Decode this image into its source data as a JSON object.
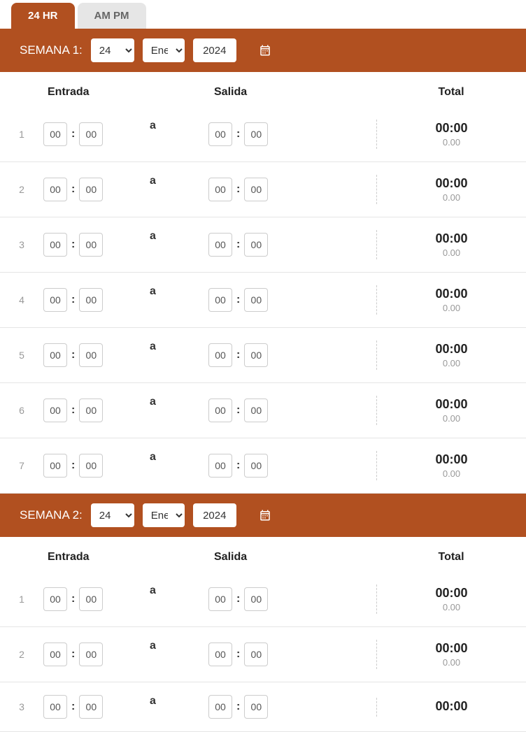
{
  "tabs": {
    "t24": "24 HR",
    "ampm": "AM PM"
  },
  "headers": {
    "entrada": "Entrada",
    "salida": "Salida",
    "total": "Total"
  },
  "a_label": "a",
  "weeks": [
    {
      "label": "SEMANA 1:",
      "day": "24",
      "month": "Enero",
      "year": "2024",
      "rows": [
        {
          "n": "1",
          "eh": "00",
          "em": "00",
          "sh": "00",
          "sm": "00",
          "tt": "00:00",
          "td": "0.00"
        },
        {
          "n": "2",
          "eh": "00",
          "em": "00",
          "sh": "00",
          "sm": "00",
          "tt": "00:00",
          "td": "0.00"
        },
        {
          "n": "3",
          "eh": "00",
          "em": "00",
          "sh": "00",
          "sm": "00",
          "tt": "00:00",
          "td": "0.00"
        },
        {
          "n": "4",
          "eh": "00",
          "em": "00",
          "sh": "00",
          "sm": "00",
          "tt": "00:00",
          "td": "0.00"
        },
        {
          "n": "5",
          "eh": "00",
          "em": "00",
          "sh": "00",
          "sm": "00",
          "tt": "00:00",
          "td": "0.00"
        },
        {
          "n": "6",
          "eh": "00",
          "em": "00",
          "sh": "00",
          "sm": "00",
          "tt": "00:00",
          "td": "0.00"
        },
        {
          "n": "7",
          "eh": "00",
          "em": "00",
          "sh": "00",
          "sm": "00",
          "tt": "00:00",
          "td": "0.00"
        }
      ]
    },
    {
      "label": "SEMANA 2:",
      "day": "24",
      "month": "Enero",
      "year": "2024",
      "rows": [
        {
          "n": "1",
          "eh": "00",
          "em": "00",
          "sh": "00",
          "sm": "00",
          "tt": "00:00",
          "td": "0.00"
        },
        {
          "n": "2",
          "eh": "00",
          "em": "00",
          "sh": "00",
          "sm": "00",
          "tt": "00:00",
          "td": "0.00"
        },
        {
          "n": "3",
          "eh": "00",
          "em": "00",
          "sh": "00",
          "sm": "00",
          "tt": "00:00",
          "td": ""
        }
      ]
    }
  ]
}
